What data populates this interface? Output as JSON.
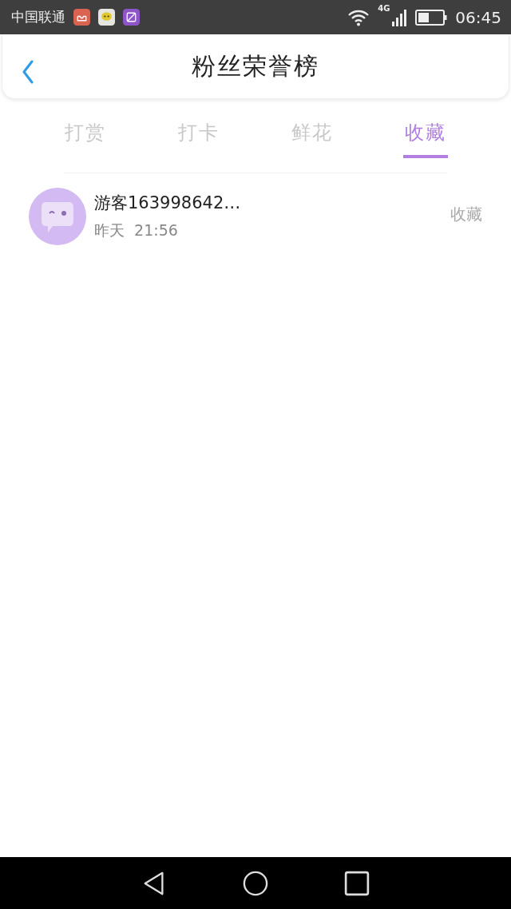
{
  "status_bar": {
    "carrier": "中国联通",
    "network": "4G",
    "time": "06:45"
  },
  "header": {
    "title": "粉丝荣誉榜"
  },
  "tabs": [
    {
      "label": "打赏",
      "selected": false
    },
    {
      "label": "打卡",
      "selected": false
    },
    {
      "label": "鲜花",
      "selected": false
    },
    {
      "label": "收藏",
      "selected": true
    }
  ],
  "fans": [
    {
      "name": "游客163998642…",
      "time": "昨天  21:56",
      "action": "收藏"
    }
  ]
}
